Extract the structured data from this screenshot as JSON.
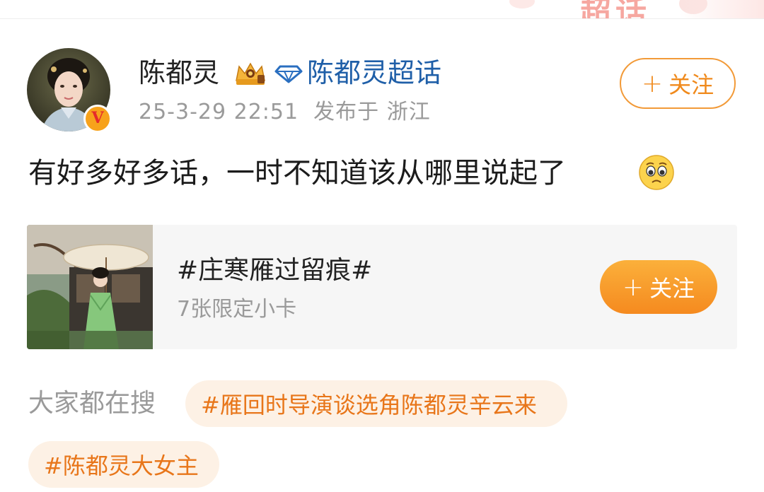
{
  "header_banner": {
    "decor_text": "超话"
  },
  "post": {
    "author": {
      "name": "陈都灵",
      "verified_badge": "V",
      "super_topic_link": "陈都灵超话",
      "icons": [
        "crown-icon",
        "diamond-icon",
        "verified-badge-icon"
      ]
    },
    "timestamp": "25-3-29 22:51",
    "location_text": "发布于 浙江",
    "follow_button": {
      "plus": "+",
      "label": "关注"
    },
    "text": "有好多好多话，一时不知道该从哪里说起了",
    "emoji": "pleading-face-icon"
  },
  "topic_card": {
    "title": "#庄寒雁过留痕#",
    "subtitle": "7张限定小卡",
    "follow_button": {
      "plus": "+",
      "label": "关注"
    }
  },
  "trending": {
    "label": "大家都在搜",
    "chips": [
      "#雁回时导演谈选角陈都灵辛云来",
      "#陈都灵大女主"
    ]
  },
  "colors": {
    "accent_orange": "#f08a1c",
    "link_blue": "#1f5fa8",
    "muted_gray": "#9a9a9a",
    "chip_bg": "#fdf1e5"
  }
}
